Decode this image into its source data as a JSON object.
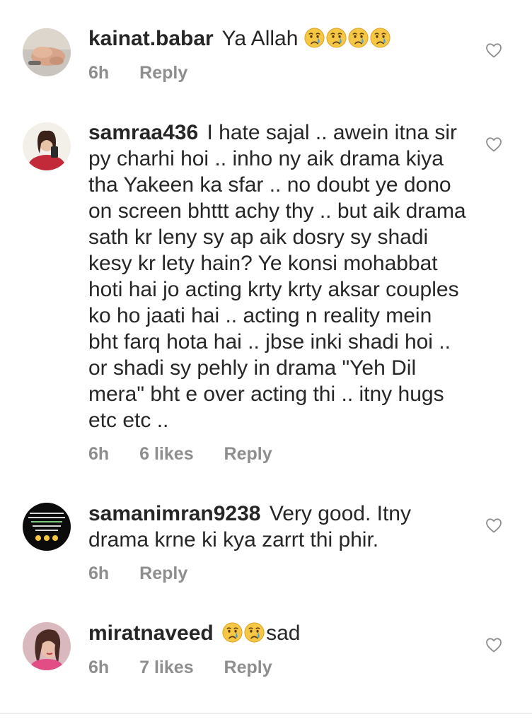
{
  "comments": [
    {
      "username": "kainat.babar",
      "text": "Ya Allah",
      "emoji_after": [
        "crying-face",
        "crying-face",
        "crying-face",
        "crying-face"
      ],
      "time": "6h",
      "likes": "",
      "reply_label": "Reply",
      "avatar_icon": "hands-photo-avatar"
    },
    {
      "username": "samraa436",
      "text": "I hate sajal .. awein itna sir py charhi hoi .. inho ny aik drama kiya tha Yakeen ka sfar .. no doubt ye dono on screen bhttt achy thy .. but aik drama sath kr leny sy ap aik dosry sy shadi kesy kr lety hain? Ye konsi mohabbat hoti hai jo acting krty krty aksar couples ko ho jaati hai .. acting n reality mein bht farq hota hai .. jbse inki shadi hoi .. or shadi sy pehly in drama \"Yeh Dil mera\" bht e over acting thi .. itny hugs etc etc ..",
      "time": "6h",
      "likes": "6 likes",
      "reply_label": "Reply",
      "avatar_icon": "woman-selfie-avatar"
    },
    {
      "username": "samanimran9238",
      "text": "Very good. Itny drama krne ki kya zarrt thi phir.",
      "time": "6h",
      "likes": "",
      "reply_label": "Reply",
      "avatar_icon": "poetry-image-avatar"
    },
    {
      "username": "miratnaveed",
      "text": "sad",
      "emoji_before": [
        "crying-face",
        "crying-face"
      ],
      "time": "6h",
      "likes": "7 likes",
      "reply_label": "Reply",
      "avatar_icon": "woman-portrait-avatar"
    }
  ],
  "colors": {
    "text": "#262626",
    "meta": "#8e8e8e",
    "emoji_face": "#f6c744",
    "emoji_tear": "#4aa3e0"
  }
}
